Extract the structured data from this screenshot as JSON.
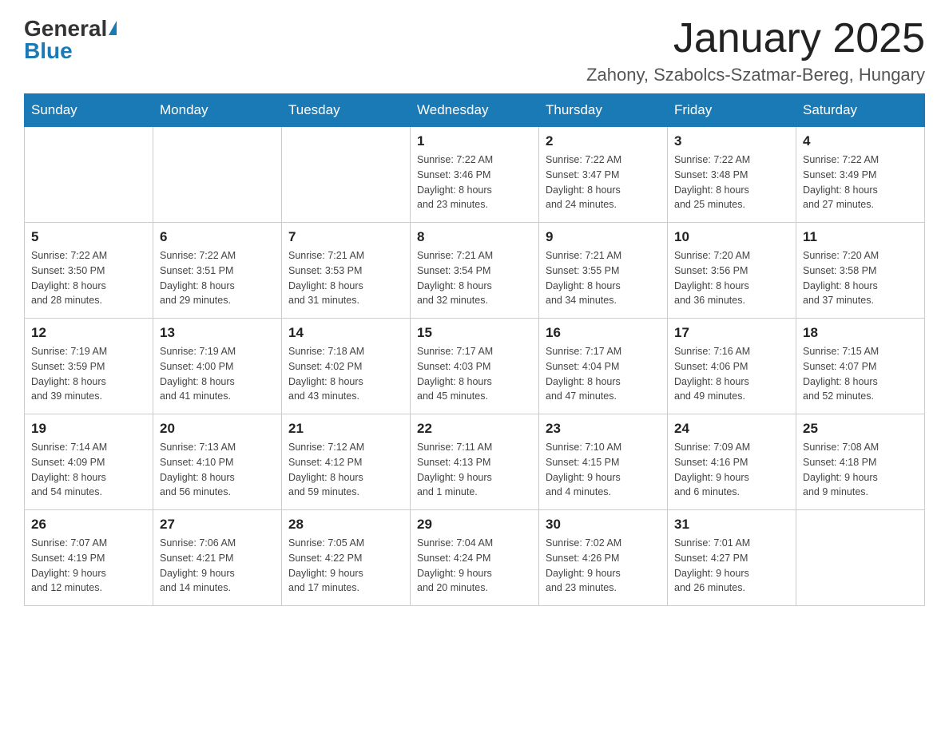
{
  "logo": {
    "general": "General",
    "blue": "Blue"
  },
  "header": {
    "title": "January 2025",
    "subtitle": "Zahony, Szabolcs-Szatmar-Bereg, Hungary"
  },
  "weekdays": [
    "Sunday",
    "Monday",
    "Tuesday",
    "Wednesday",
    "Thursday",
    "Friday",
    "Saturday"
  ],
  "weeks": [
    [
      {
        "day": "",
        "info": ""
      },
      {
        "day": "",
        "info": ""
      },
      {
        "day": "",
        "info": ""
      },
      {
        "day": "1",
        "info": "Sunrise: 7:22 AM\nSunset: 3:46 PM\nDaylight: 8 hours\nand 23 minutes."
      },
      {
        "day": "2",
        "info": "Sunrise: 7:22 AM\nSunset: 3:47 PM\nDaylight: 8 hours\nand 24 minutes."
      },
      {
        "day": "3",
        "info": "Sunrise: 7:22 AM\nSunset: 3:48 PM\nDaylight: 8 hours\nand 25 minutes."
      },
      {
        "day": "4",
        "info": "Sunrise: 7:22 AM\nSunset: 3:49 PM\nDaylight: 8 hours\nand 27 minutes."
      }
    ],
    [
      {
        "day": "5",
        "info": "Sunrise: 7:22 AM\nSunset: 3:50 PM\nDaylight: 8 hours\nand 28 minutes."
      },
      {
        "day": "6",
        "info": "Sunrise: 7:22 AM\nSunset: 3:51 PM\nDaylight: 8 hours\nand 29 minutes."
      },
      {
        "day": "7",
        "info": "Sunrise: 7:21 AM\nSunset: 3:53 PM\nDaylight: 8 hours\nand 31 minutes."
      },
      {
        "day": "8",
        "info": "Sunrise: 7:21 AM\nSunset: 3:54 PM\nDaylight: 8 hours\nand 32 minutes."
      },
      {
        "day": "9",
        "info": "Sunrise: 7:21 AM\nSunset: 3:55 PM\nDaylight: 8 hours\nand 34 minutes."
      },
      {
        "day": "10",
        "info": "Sunrise: 7:20 AM\nSunset: 3:56 PM\nDaylight: 8 hours\nand 36 minutes."
      },
      {
        "day": "11",
        "info": "Sunrise: 7:20 AM\nSunset: 3:58 PM\nDaylight: 8 hours\nand 37 minutes."
      }
    ],
    [
      {
        "day": "12",
        "info": "Sunrise: 7:19 AM\nSunset: 3:59 PM\nDaylight: 8 hours\nand 39 minutes."
      },
      {
        "day": "13",
        "info": "Sunrise: 7:19 AM\nSunset: 4:00 PM\nDaylight: 8 hours\nand 41 minutes."
      },
      {
        "day": "14",
        "info": "Sunrise: 7:18 AM\nSunset: 4:02 PM\nDaylight: 8 hours\nand 43 minutes."
      },
      {
        "day": "15",
        "info": "Sunrise: 7:17 AM\nSunset: 4:03 PM\nDaylight: 8 hours\nand 45 minutes."
      },
      {
        "day": "16",
        "info": "Sunrise: 7:17 AM\nSunset: 4:04 PM\nDaylight: 8 hours\nand 47 minutes."
      },
      {
        "day": "17",
        "info": "Sunrise: 7:16 AM\nSunset: 4:06 PM\nDaylight: 8 hours\nand 49 minutes."
      },
      {
        "day": "18",
        "info": "Sunrise: 7:15 AM\nSunset: 4:07 PM\nDaylight: 8 hours\nand 52 minutes."
      }
    ],
    [
      {
        "day": "19",
        "info": "Sunrise: 7:14 AM\nSunset: 4:09 PM\nDaylight: 8 hours\nand 54 minutes."
      },
      {
        "day": "20",
        "info": "Sunrise: 7:13 AM\nSunset: 4:10 PM\nDaylight: 8 hours\nand 56 minutes."
      },
      {
        "day": "21",
        "info": "Sunrise: 7:12 AM\nSunset: 4:12 PM\nDaylight: 8 hours\nand 59 minutes."
      },
      {
        "day": "22",
        "info": "Sunrise: 7:11 AM\nSunset: 4:13 PM\nDaylight: 9 hours\nand 1 minute."
      },
      {
        "day": "23",
        "info": "Sunrise: 7:10 AM\nSunset: 4:15 PM\nDaylight: 9 hours\nand 4 minutes."
      },
      {
        "day": "24",
        "info": "Sunrise: 7:09 AM\nSunset: 4:16 PM\nDaylight: 9 hours\nand 6 minutes."
      },
      {
        "day": "25",
        "info": "Sunrise: 7:08 AM\nSunset: 4:18 PM\nDaylight: 9 hours\nand 9 minutes."
      }
    ],
    [
      {
        "day": "26",
        "info": "Sunrise: 7:07 AM\nSunset: 4:19 PM\nDaylight: 9 hours\nand 12 minutes."
      },
      {
        "day": "27",
        "info": "Sunrise: 7:06 AM\nSunset: 4:21 PM\nDaylight: 9 hours\nand 14 minutes."
      },
      {
        "day": "28",
        "info": "Sunrise: 7:05 AM\nSunset: 4:22 PM\nDaylight: 9 hours\nand 17 minutes."
      },
      {
        "day": "29",
        "info": "Sunrise: 7:04 AM\nSunset: 4:24 PM\nDaylight: 9 hours\nand 20 minutes."
      },
      {
        "day": "30",
        "info": "Sunrise: 7:02 AM\nSunset: 4:26 PM\nDaylight: 9 hours\nand 23 minutes."
      },
      {
        "day": "31",
        "info": "Sunrise: 7:01 AM\nSunset: 4:27 PM\nDaylight: 9 hours\nand 26 minutes."
      },
      {
        "day": "",
        "info": ""
      }
    ]
  ]
}
